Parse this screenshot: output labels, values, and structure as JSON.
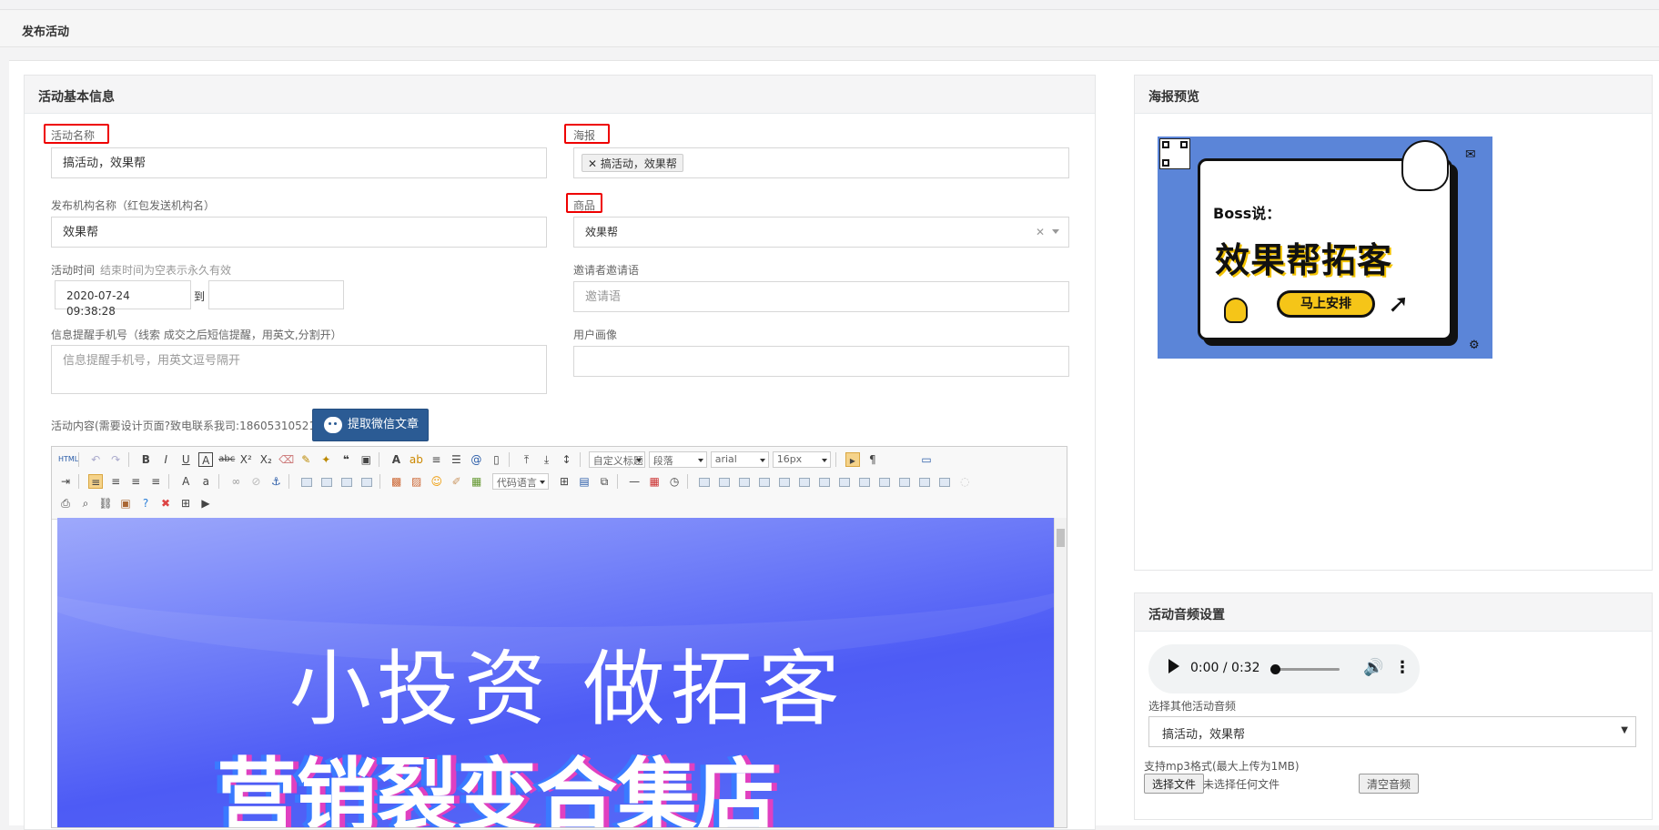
{
  "page": {
    "title": "发布活动"
  },
  "basic": {
    "panel_title": "活动基本信息",
    "name_label": "活动名称",
    "name_value": "搞活动，效果帮",
    "org_label": "发布机构名称（红包发送机构名）",
    "org_value": "效果帮",
    "time_label": "活动时间",
    "time_hint": "结束时间为空表示永久有效",
    "time_start": "2020-07-24 09:38:28",
    "time_to": "到",
    "time_end": "",
    "phone_label": "信息提醒手机号（线索 成交之后短信提醒，用英文,分割开）",
    "phone_placeholder": "信息提醒手机号，用英文逗号隔开",
    "poster_label": "海报",
    "poster_tag": "搞活动，效果帮",
    "goods_label": "商品",
    "goods_value": "效果帮",
    "invite_label": "邀请者邀请语",
    "invite_placeholder": "邀请语",
    "avatar_label": "用户画像",
    "content_label": "活动内容(需要设计页面?致电联系我司:18605310521)",
    "wechat_button": "提取微信文章"
  },
  "editor": {
    "selects": {
      "title": "自定义标题",
      "para": "段落",
      "font": "arial",
      "size": "16px",
      "code": "代码语言"
    },
    "content_line1": "小投资 做拓客",
    "content_line2": "营销裂变合集店"
  },
  "poster_preview": {
    "panel_title": "海报预览",
    "boss": "Boss说：",
    "brand": "效果帮拓客",
    "pill": "马上安排"
  },
  "audio": {
    "panel_title": "活动音频设置",
    "time": "0:00 / 0:32",
    "progress": 0,
    "select_label": "选择其他活动音频",
    "select_value": "搞活动，效果帮",
    "format_hint": "支持mp3格式(最大上传为1MB)",
    "choose_file": "选择文件",
    "no_file": "未选择任何文件",
    "clear": "清空音频"
  }
}
